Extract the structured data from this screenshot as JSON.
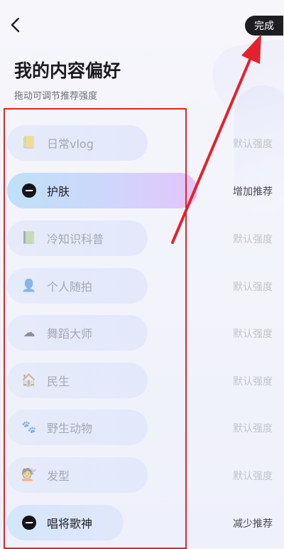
{
  "header": {
    "done_label": "完成"
  },
  "page": {
    "title": "我的内容偏好",
    "subtitle": "拖动可调节推荐强度"
  },
  "topics": [
    {
      "label": "日常vlog",
      "strength": "默认强度",
      "state": "default",
      "icon": "notebook-icon"
    },
    {
      "label": "护肤",
      "strength": "增加推荐",
      "state": "increase",
      "icon": "minus-circle-icon"
    },
    {
      "label": "冷知识科普",
      "strength": "默认强度",
      "state": "default",
      "icon": "book-icon"
    },
    {
      "label": "个人随拍",
      "strength": "默认强度",
      "state": "default",
      "icon": "person-icon"
    },
    {
      "label": "舞蹈大师",
      "strength": "默认强度",
      "state": "default",
      "icon": "cloud-icon"
    },
    {
      "label": "民生",
      "strength": "默认强度",
      "state": "default",
      "icon": "house-icon"
    },
    {
      "label": "野生动物",
      "strength": "默认强度",
      "state": "default",
      "icon": "animal-icon"
    },
    {
      "label": "发型",
      "strength": "默认强度",
      "state": "default",
      "icon": "hair-icon"
    },
    {
      "label": "唱将歌神",
      "strength": "减少推荐",
      "state": "decrease",
      "icon": "minus-circle-icon"
    }
  ],
  "colors": {
    "annotation_red": "#e3222b",
    "done_button_bg": "#1d1d22"
  }
}
